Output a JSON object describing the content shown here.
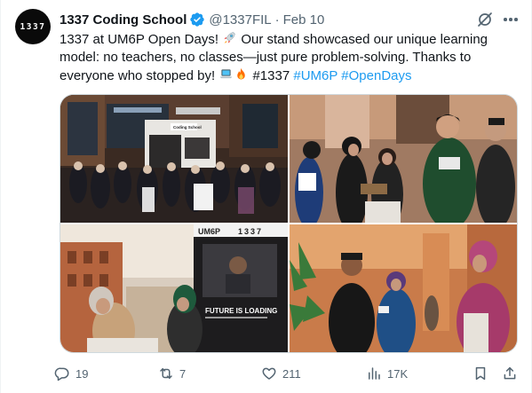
{
  "author": {
    "avatar_text": "1337",
    "name": "1337 Coding School",
    "handle": "@1337FIL",
    "separator": "·",
    "date": "Feb 10",
    "verified_color": "#1d9bf0"
  },
  "tweet": {
    "line1_a": "1337 at UM6P Open Days!",
    "line1_b": "Our stand showcased our unique learning",
    "line2": "model: no teachers, no classes—just pure problem-solving. Thanks to",
    "line3_a": "everyone who stopped by!",
    "line3_b": "#1337",
    "hashtag_1": "#UM6P",
    "hashtag_2": "#OpenDays",
    "emojis": [
      "rocket",
      "laptop",
      "fire"
    ]
  },
  "media": {
    "photos": [
      {
        "id": "stand-crowd",
        "sign": "Coding School"
      },
      {
        "id": "students-talking"
      },
      {
        "id": "poster-interview",
        "poster_brand_a": "UM6P",
        "poster_brand_b": "1337",
        "poster_headline": "FUTURE IS LOADING"
      },
      {
        "id": "visitors-chatting"
      }
    ]
  },
  "actions": {
    "replies": "19",
    "reposts": "7",
    "likes": "211",
    "views": "17K"
  },
  "colors": {
    "text": "#0f1419",
    "secondary": "#536471",
    "accent": "#1d9bf0",
    "border": "#cfd9de"
  }
}
